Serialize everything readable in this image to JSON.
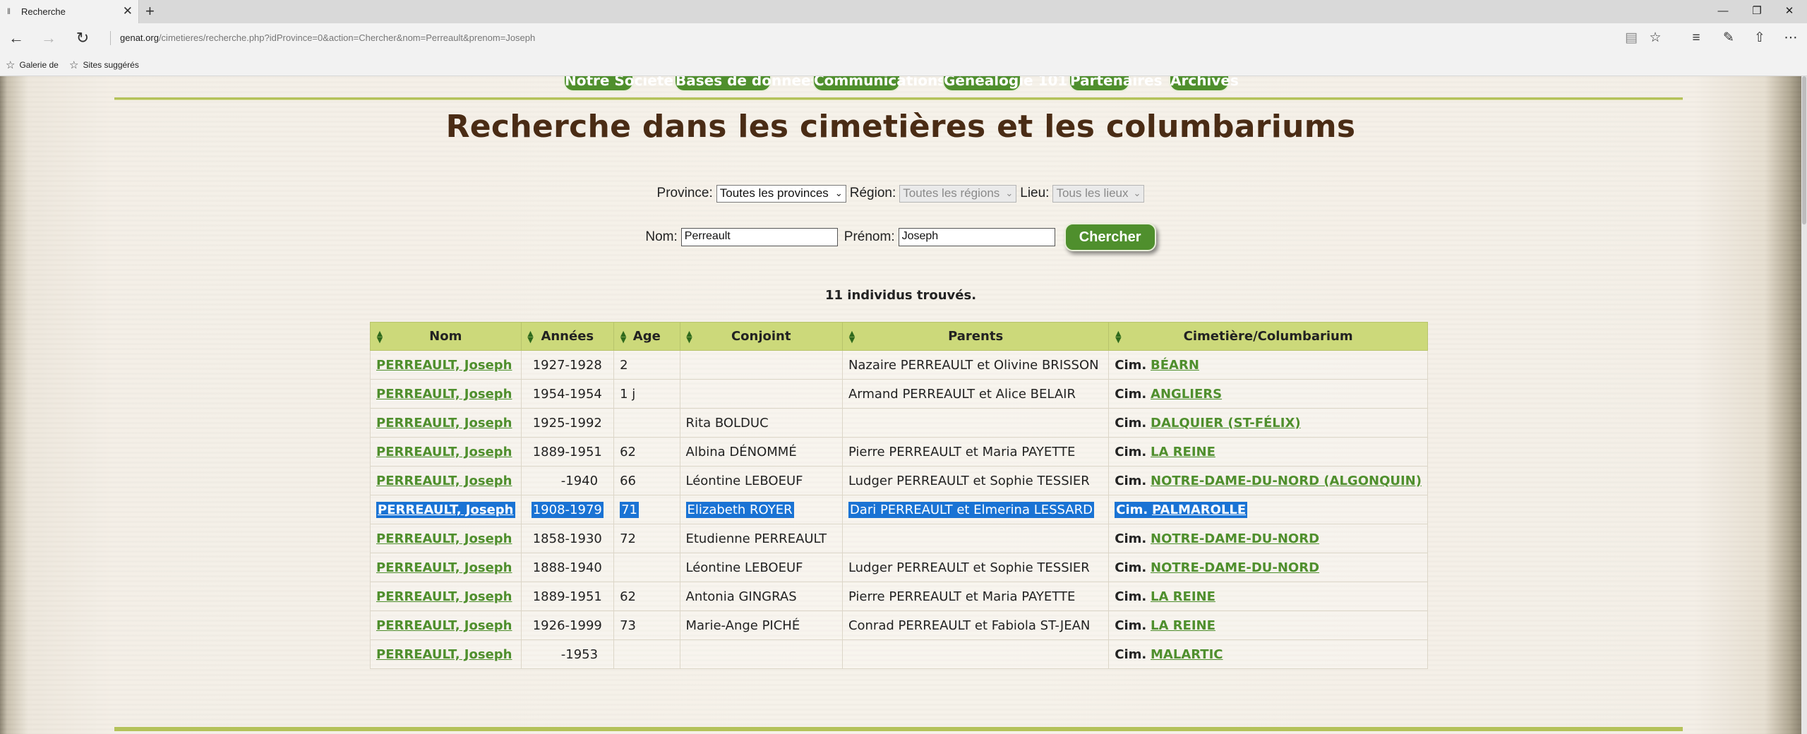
{
  "browser": {
    "tab_title": "Recherche",
    "tab_close": "✕",
    "new_tab": "+",
    "url_host": "genat.org",
    "url_path": "/cimetieres/recherche.php?idProvince=0&action=Chercher&nom=Perreault&prenom=Joseph",
    "favorites": [
      {
        "label": "Galerie de"
      },
      {
        "label": "Sites suggérés"
      }
    ]
  },
  "site_nav": [
    {
      "label": "Notre Société"
    },
    {
      "label": "Bases de données"
    },
    {
      "label": "Communications"
    },
    {
      "label": "Généalogie 101"
    },
    {
      "label": "Partenaires"
    },
    {
      "label": "Archives"
    }
  ],
  "page": {
    "title": "Recherche dans les cimetières et les columbariums"
  },
  "filters": {
    "province_label": "Province:",
    "province_value": "Toutes les provinces",
    "region_label": "Région:",
    "region_value": "Toutes les régions",
    "lieu_label": "Lieu:",
    "lieu_value": "Tous les lieux"
  },
  "search": {
    "nom_label": "Nom:",
    "nom_value": "Perreault",
    "prenom_label": "Prénom:",
    "prenom_value": "Joseph",
    "button_label": "Chercher"
  },
  "results": {
    "count_text": "11 individus trouvés.",
    "columns": [
      "Nom",
      "Années",
      "Age",
      "Conjoint",
      "Parents",
      "Cimetière/Columbarium"
    ],
    "cim_prefix": "Cim.",
    "rows": [
      {
        "nom": "PERREAULT, Joseph",
        "annees": "1927-1928",
        "age": "2",
        "conjoint": "",
        "parents": "Nazaire PERREAULT et Olivine BRISSON",
        "cimetiere": "BÉARN"
      },
      {
        "nom": "PERREAULT, Joseph",
        "annees": "1954-1954",
        "age": "1 j",
        "conjoint": "",
        "parents": "Armand PERREAULT et Alice BELAIR",
        "cimetiere": "ANGLIERS"
      },
      {
        "nom": "PERREAULT, Joseph",
        "annees": "1925-1992",
        "age": "",
        "conjoint": "Rita BOLDUC",
        "parents": "",
        "cimetiere": "DALQUIER (ST-FÉLIX)"
      },
      {
        "nom": "PERREAULT, Joseph",
        "annees": "1889-1951",
        "age": "62",
        "conjoint": "Albina DÉNOMMÉ",
        "parents": "Pierre PERREAULT et Maria PAYETTE",
        "cimetiere": "LA REINE"
      },
      {
        "nom": "PERREAULT, Joseph",
        "annees": "-1940",
        "age": "66",
        "conjoint": "Léontine LEBOEUF",
        "parents": "Ludger PERREAULT et Sophie TESSIER",
        "cimetiere": "NOTRE-DAME-DU-NORD (ALGONQUIN)"
      },
      {
        "nom": "PERREAULT, Joseph",
        "annees": "1908-1979",
        "age": "71",
        "conjoint": "Elizabeth ROYER",
        "parents": "Dari PERREAULT et Elmerina LESSARD",
        "cimetiere": "PALMAROLLE"
      },
      {
        "nom": "PERREAULT, Joseph",
        "annees": "1858-1930",
        "age": "72",
        "conjoint": "Etudienne PERREAULT",
        "parents": "",
        "cimetiere": "NOTRE-DAME-DU-NORD"
      },
      {
        "nom": "PERREAULT, Joseph",
        "annees": "1888-1940",
        "age": "",
        "conjoint": "Léontine LEBOEUF",
        "parents": "Ludger PERREAULT et Sophie TESSIER",
        "cimetiere": "NOTRE-DAME-DU-NORD"
      },
      {
        "nom": "PERREAULT, Joseph",
        "annees": "1889-1951",
        "age": "62",
        "conjoint": "Antonia GINGRAS",
        "parents": "Pierre PERREAULT et Maria PAYETTE",
        "cimetiere": "LA REINE"
      },
      {
        "nom": "PERREAULT, Joseph",
        "annees": "1926-1999",
        "age": "73",
        "conjoint": "Marie-Ange PICHÉ",
        "parents": "Conrad PERREAULT et Fabiola ST-JEAN",
        "cimetiere": "LA REINE"
      },
      {
        "nom": "PERREAULT, Joseph",
        "annees": "-1953",
        "age": "",
        "conjoint": "",
        "parents": "",
        "cimetiere": "MALARTIC"
      }
    ],
    "highlighted_row_index": 5
  },
  "colors": {
    "accent_green": "#4f8f2d",
    "header_green": "#ccd97a",
    "title_brown": "#4a2c15",
    "selection_blue": "#1a73d4"
  },
  "icons": {
    "back": "arrow-left-icon",
    "forward": "arrow-right-icon",
    "refresh": "refresh-icon",
    "reading_view": "book-icon",
    "favorite": "star-icon",
    "hub": "hub-icon",
    "notes": "pen-icon",
    "share": "share-icon",
    "more": "more-icon",
    "sort": "sort-icon"
  }
}
